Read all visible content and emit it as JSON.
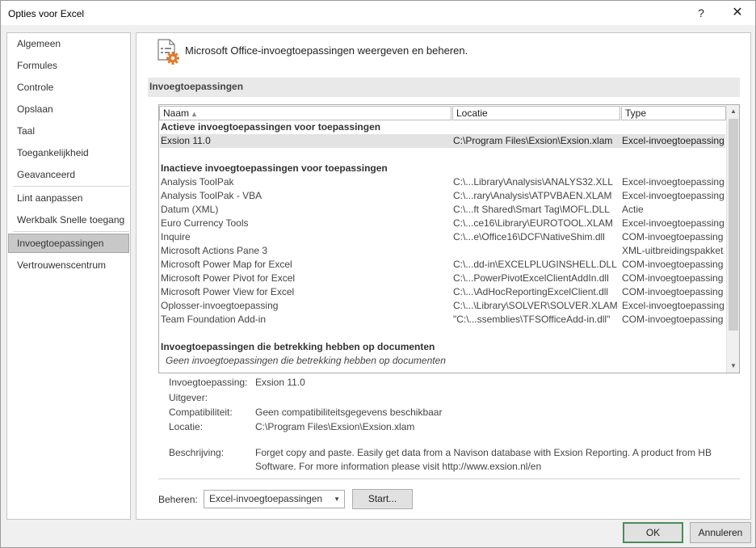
{
  "window": {
    "title": "Opties voor Excel",
    "help_label": "?",
    "close_label": "✕"
  },
  "nav": {
    "items": [
      {
        "label": "Algemeen"
      },
      {
        "label": "Formules"
      },
      {
        "label": "Controle"
      },
      {
        "label": "Opslaan"
      },
      {
        "label": "Taal"
      },
      {
        "label": "Toegankelijkheid"
      },
      {
        "label": "Geavanceerd"
      },
      {
        "label": "Lint aanpassen"
      },
      {
        "label": "Werkbalk Snelle toegang"
      },
      {
        "label": "Invoegtoepassingen",
        "selected": true
      },
      {
        "label": "Vertrouwenscentrum"
      }
    ]
  },
  "header": {
    "text": "Microsoft Office-invoegtoepassingen weergeven en beheren."
  },
  "section": {
    "title": "Invoegtoepassingen"
  },
  "table": {
    "columns": [
      "Naam",
      "Locatie",
      "Type"
    ],
    "sort_indicator": "▲",
    "active_group": "Actieve invoegtoepassingen voor toepassingen",
    "active_rows": [
      {
        "name": "Exsion 11.0",
        "location": "C:\\Program Files\\Exsion\\Exsion.xlam",
        "type": "Excel-invoegtoepassing"
      }
    ],
    "inactive_group": "Inactieve invoegtoepassingen voor toepassingen",
    "inactive_rows": [
      {
        "name": "Analysis ToolPak",
        "location": "C:\\...Library\\Analysis\\ANALYS32.XLL",
        "type": "Excel-invoegtoepassing"
      },
      {
        "name": "Analysis ToolPak - VBA",
        "location": "C:\\...rary\\Analysis\\ATPVBAEN.XLAM",
        "type": "Excel-invoegtoepassing"
      },
      {
        "name": "Datum (XML)",
        "location": "C:\\...ft Shared\\Smart Tag\\MOFL.DLL",
        "type": "Actie"
      },
      {
        "name": "Euro Currency Tools",
        "location": "C:\\...ce16\\Library\\EUROTOOL.XLAM",
        "type": "Excel-invoegtoepassing"
      },
      {
        "name": "Inquire",
        "location": "C:\\...e\\Office16\\DCF\\NativeShim.dll",
        "type": "COM-invoegtoepassing"
      },
      {
        "name": "Microsoft Actions Pane 3",
        "location": "",
        "type": "XML-uitbreidingspakket"
      },
      {
        "name": "Microsoft Power Map for Excel",
        "location": "C:\\...dd-in\\EXCELPLUGINSHELL.DLL",
        "type": "COM-invoegtoepassing"
      },
      {
        "name": "Microsoft Power Pivot for Excel",
        "location": "C:\\...PowerPivotExcelClientAddIn.dll",
        "type": "COM-invoegtoepassing"
      },
      {
        "name": "Microsoft Power View for Excel",
        "location": "C:\\...\\AdHocReportingExcelClient.dll",
        "type": "COM-invoegtoepassing"
      },
      {
        "name": "Oplosser-invoegtoepassing",
        "location": "C:\\...\\Library\\SOLVER\\SOLVER.XLAM",
        "type": "Excel-invoegtoepassing"
      },
      {
        "name": "Team Foundation Add-in",
        "location": "\"C:\\...ssemblies\\TFSOfficeAdd-in.dll\"",
        "type": "COM-invoegtoepassing"
      }
    ],
    "document_group": "Invoegtoepassingen die betrekking hebben op documenten",
    "document_empty": "Geen invoegtoepassingen die betrekking hebben op documenten",
    "scroll_up": "▲",
    "scroll_down": "▼"
  },
  "details": {
    "addin_label": "Invoegtoepassing:",
    "addin_value": "Exsion 11.0",
    "publisher_label": "Uitgever:",
    "publisher_value": "",
    "compat_label": "Compatibiliteit:",
    "compat_value": "Geen compatibiliteitsgegevens beschikbaar",
    "location_label": "Locatie:",
    "location_value": "C:\\Program Files\\Exsion\\Exsion.xlam",
    "description_label": "Beschrijving:",
    "description_value": "Forget copy and paste. Easily get data from a Navison database with Exsion Reporting. A product from HB Software. For more information please visit http://www.exsion.nl/en"
  },
  "manage": {
    "label": "Beheren:",
    "selected": "Excel-invoegtoepassingen",
    "arrow": "▼",
    "start_label": "Start..."
  },
  "footer": {
    "ok_label": "OK",
    "cancel_label": "Annuleren"
  },
  "colors": {
    "selected_nav": "#c8c8c8",
    "ok_border": "#4a8c5a",
    "icon_orange": "#e07b2a"
  }
}
